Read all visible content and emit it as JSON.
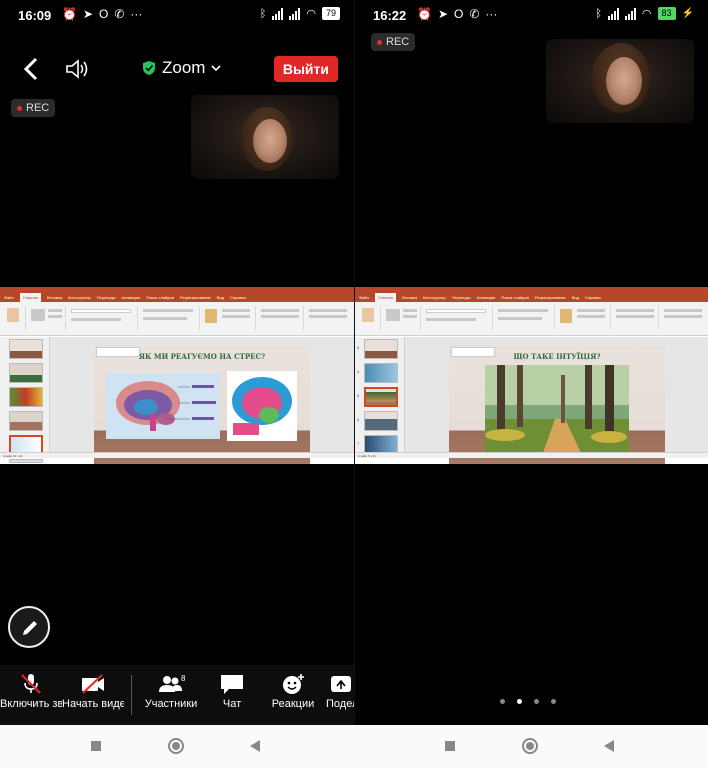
{
  "left": {
    "status": {
      "time": "16:09",
      "battery": "79"
    },
    "toolbar": {
      "app_title": "Zoom",
      "leave_label": "Выйти"
    },
    "rec_label": "REC",
    "shared_slide": {
      "title": "ЯК МИ РЕАГУЄМО НА СТРЕС?",
      "slide_number_text": "Слайд 16 з 21"
    },
    "meeting_controls": [
      {
        "label": "Включить звук",
        "icon": "mic-off-icon"
      },
      {
        "label": "Начать видео",
        "icon": "video-off-icon"
      },
      {
        "label": "Участники",
        "icon": "participants-icon",
        "badge": "8"
      },
      {
        "label": "Чат",
        "icon": "chat-icon"
      },
      {
        "label": "Реакции",
        "icon": "reaction-icon"
      },
      {
        "label": "Поделиться",
        "icon": "share-icon"
      }
    ]
  },
  "right": {
    "status": {
      "time": "16:22",
      "battery": "83"
    },
    "rec_label": "REC",
    "shared_slide": {
      "title": "ЩО ТАКЕ ІНТУЇЦІЯ?",
      "slide_number_text": "Слайд 5 з 21"
    },
    "page_indicator": {
      "count": 4,
      "active_index": 1
    }
  },
  "ppt_menu": [
    "Файл",
    "Главная",
    "Вставка",
    "Конструктор",
    "Переходы",
    "Анимация",
    "Показ слайдов",
    "Рецензирование",
    "Вид",
    "Справка"
  ],
  "colors": {
    "leave_button": "#e02828",
    "ppt_accent": "#b7472a",
    "shield_green": "#22c55e",
    "slide_title_green": "#2e6b3a"
  }
}
